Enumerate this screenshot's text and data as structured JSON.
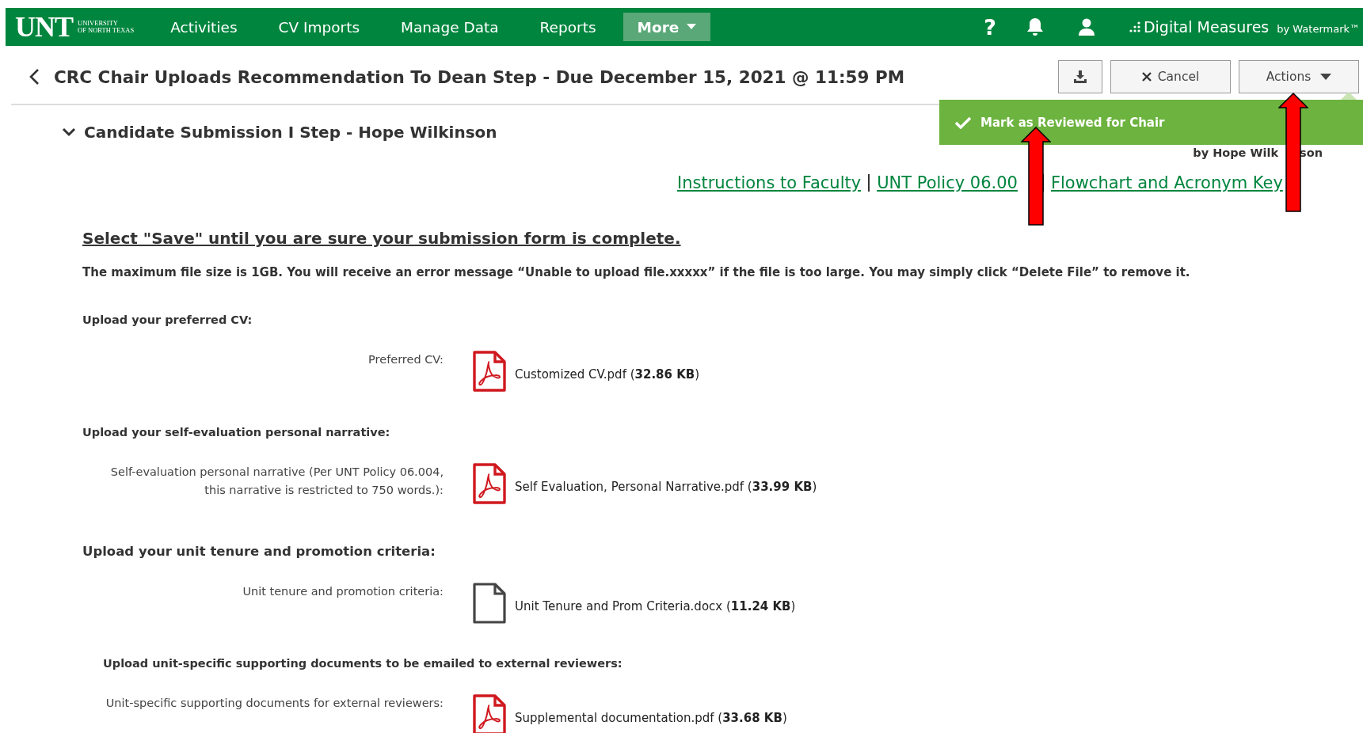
{
  "navbar": {
    "logo": {
      "mark": "UNT",
      "subtitle": [
        "UNIVERSITY",
        "OF NORTH TEXAS"
      ]
    },
    "items": [
      {
        "label": "Activities",
        "selected": false,
        "kind": "link"
      },
      {
        "label": "CV Imports",
        "selected": false,
        "kind": "link"
      },
      {
        "label": "Manage Data",
        "selected": false,
        "kind": "link"
      },
      {
        "label": "Reports",
        "selected": false,
        "kind": "link"
      },
      {
        "label": "More",
        "selected": true,
        "kind": "dropdown"
      }
    ],
    "help": "?",
    "brand": "Digital Measures",
    "brand_by": "by Watermark™"
  },
  "header": {
    "title": "CRC Chair Uploads Recommendation To Dean Step - Due December 15, 2021 @ 11:59 PM",
    "buttons": [
      {
        "kind": "download"
      },
      {
        "kind": "cancel",
        "label": "Cancel"
      },
      {
        "kind": "actions",
        "label": "Actions"
      }
    ]
  },
  "actions_menu": {
    "items": [
      {
        "label": "Mark as Reviewed for Chair",
        "checked": true
      }
    ]
  },
  "section": {
    "title": "Candidate Submission I Step - Hope Wilkinson",
    "expanded": true,
    "byline": [
      "by Hope Wilk",
      "son"
    ]
  },
  "links": [
    "Instructions to Faculty",
    "UNT Policy 06.00",
    "Flowchart and Acronym Key"
  ],
  "instructions": {
    "heading": "Select \"Save\" until you are sure your submission form is complete.",
    "note": "The maximum file size is 1GB.  You will receive an error message “Unable to upload file.xxxxx” if the file is too large. You may simply click “Delete File” to remove it."
  },
  "groups": [
    {
      "heading": "Upload your preferred CV:",
      "kind": "normal",
      "field": {
        "label": "Preferred CV:",
        "file": {
          "kind": "pdf",
          "text": "Customized CV.pdf (**32.86 KB**)"
        }
      }
    },
    {
      "heading": "Upload your self-evaluation personal narrative:",
      "kind": "normal",
      "field": {
        "label": "Self-evaluation personal narrative (Per UNT Policy 06.004, this narrative is restricted to 750 words.):",
        "file": {
          "kind": "pdf",
          "text": "Self Evaluation, Personal Narrative.pdf (**33.99 KB**)"
        }
      }
    },
    {
      "heading": "Upload your unit tenure and promotion criteria:",
      "kind": "large",
      "field": {
        "label": "Unit tenure and promotion criteria:",
        "file": {
          "kind": "document",
          "text": "Unit Tenure and Prom Criteria.docx (**11.24 KB**)"
        }
      }
    },
    {
      "heading": "Upload unit-specific supporting documents to be emailed to external reviewers:",
      "kind": "indented",
      "field": {
        "label": "Unit-specific supporting documents for external reviewers:",
        "file": {
          "kind": "pdf",
          "text": "Supplemental documentation.pdf (**33.68 KB**)"
        }
      }
    }
  ],
  "annotations": [
    {
      "kind": "arrow"
    },
    {
      "kind": "arrow"
    }
  ]
}
